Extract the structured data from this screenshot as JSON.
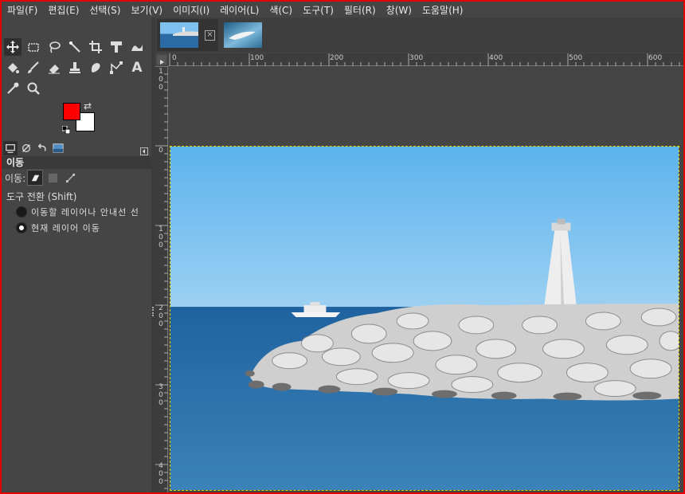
{
  "menu": [
    "파일(F)",
    "편집(E)",
    "선택(S)",
    "보기(V)",
    "이미지(I)",
    "레이어(L)",
    "색(C)",
    "도구(T)",
    "필터(R)",
    "창(W)",
    "도움말(H)"
  ],
  "tools": [
    {
      "name": "move-tool-icon",
      "glyph": "move"
    },
    {
      "name": "rect-select-icon",
      "glyph": "rect"
    },
    {
      "name": "lasso-select-icon",
      "glyph": "lasso"
    },
    {
      "name": "fuzzy-select-icon",
      "glyph": "wand"
    },
    {
      "name": "crop-tool-icon",
      "glyph": "crop"
    },
    {
      "name": "unified-transform-icon",
      "glyph": "transform"
    },
    {
      "name": "warp-transform-icon",
      "glyph": "warp"
    },
    {
      "name": "bucket-fill-icon",
      "glyph": "bucket"
    },
    {
      "name": "paintbrush-icon",
      "glyph": "brush"
    },
    {
      "name": "eraser-icon",
      "glyph": "eraser"
    },
    {
      "name": "clone-tool-icon",
      "glyph": "clone"
    },
    {
      "name": "smudge-tool-icon",
      "glyph": "smudge"
    },
    {
      "name": "paths-tool-icon",
      "glyph": "path"
    },
    {
      "name": "text-tool-icon",
      "glyph": "text"
    },
    {
      "name": "color-picker-icon",
      "glyph": "picker"
    },
    {
      "name": "zoom-tool-icon",
      "glyph": "zoom"
    }
  ],
  "colors": {
    "foreground": "#ff0000",
    "background": "#ffffff",
    "accent_border": "#e00000"
  },
  "tool_options": {
    "title": "이동",
    "move_label": "이동:",
    "toggle_label": "도구 전환 (Shift)",
    "option1": "이동할 레이어나 안내선 선",
    "option2": "현재 레이어 이동",
    "selected_option": "option2"
  },
  "rulers": {
    "h": [
      "0",
      "100",
      "200",
      "300",
      "400",
      "500",
      "600"
    ],
    "v": [
      "100",
      "0",
      "100",
      "200",
      "300",
      "400"
    ]
  }
}
